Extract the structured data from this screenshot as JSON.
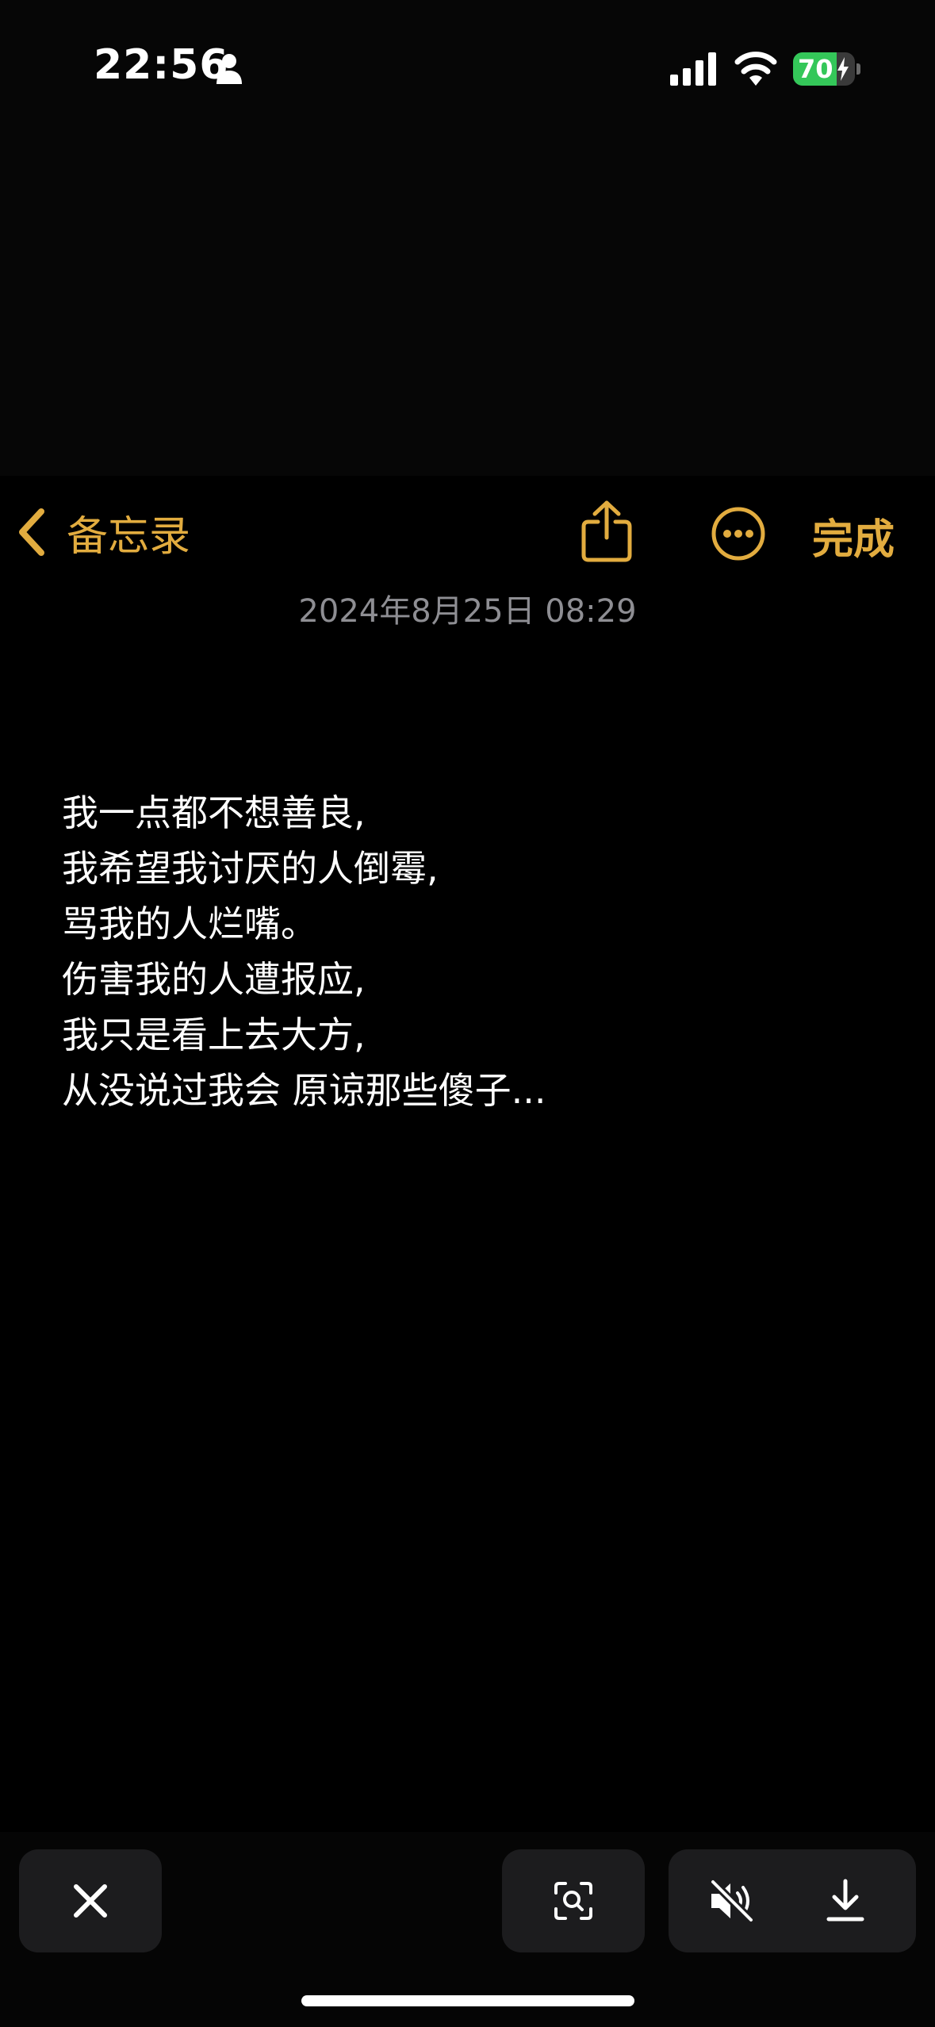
{
  "status_bar": {
    "time": "22:56",
    "battery_level": "70",
    "battery_fraction": 0.7,
    "icons": [
      "person-icon",
      "cellular-signal-icon",
      "wifi-icon",
      "battery-charging-icon"
    ]
  },
  "nav": {
    "back_label": "备忘录",
    "done_label": "完成",
    "icons": [
      "chevron-left-icon",
      "share-icon",
      "more-ellipsis-icon"
    ]
  },
  "note": {
    "date": "2024年8月25日 08:29",
    "lines": [
      "我一点都不想善良,",
      "我希望我讨厌的人倒霉,",
      "骂我的人烂嘴。",
      "伤害我的人遭报应,",
      "我只是看上去大方,",
      "从没说过我会 原谅那些傻子..."
    ]
  },
  "bottom_controls": {
    "icons": [
      "close-icon",
      "visual-lookup-icon",
      "speaker-muted-icon",
      "download-icon"
    ]
  },
  "colors": {
    "accent": "#e2ac3f",
    "background": "#000000",
    "secondary_text": "#8e8e93",
    "control_bg": "#1c1c1e",
    "battery_green": "#34c759"
  }
}
